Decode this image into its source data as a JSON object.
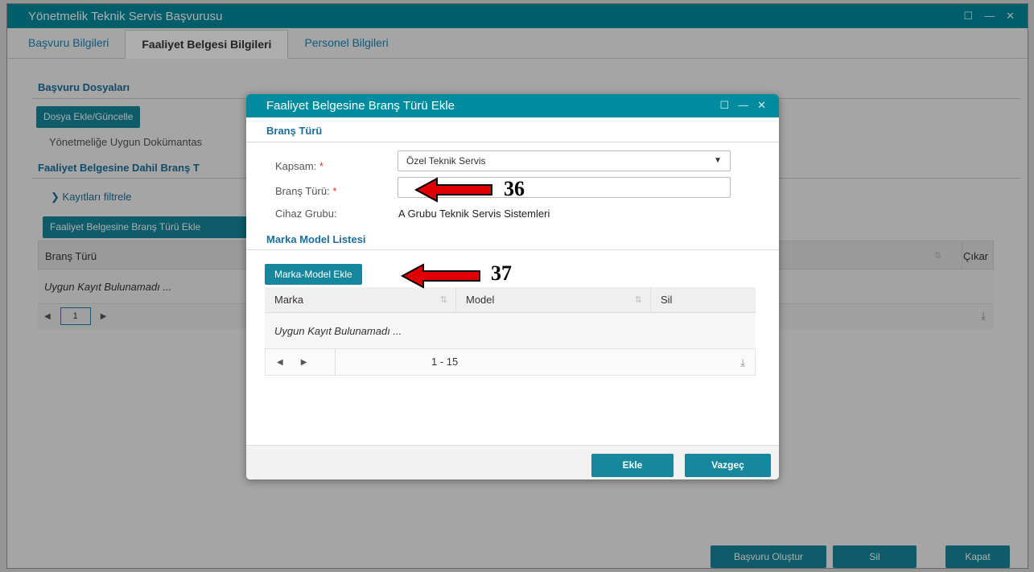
{
  "window": {
    "title": "Yönetmelik Teknik Servis Başvurusu"
  },
  "tabs": [
    {
      "label": "Başvuru Bilgileri"
    },
    {
      "label": "Faaliyet Belgesi Bilgileri"
    },
    {
      "label": "Personel Bilgileri"
    }
  ],
  "background": {
    "section_files": "Başvuru Dosyaları",
    "file_button": "Dosya Ekle/Güncelle",
    "file_text": "Yönetmeliğe Uygun Dokümantas",
    "section_branch": "Faaliyet Belgesine Dahil Branş T",
    "filter_label": "Kayıtları filtrele",
    "add_branch_button": "Faaliyet Belgesine Branş Türü Ekle",
    "col_branch": "Branş Türü",
    "col_remove": "Çıkar",
    "empty_text": "Uygun Kayıt Bulunamadı ...",
    "page_number": "1"
  },
  "footer": {
    "create_button": "Başvuru Oluştur",
    "delete_button": "Sil",
    "close_button": "Kapat"
  },
  "modal": {
    "title": "Faaliyet Belgesine Branş Türü Ekle",
    "section_branch": "Branş Türü",
    "scope_label": "Kapsam:",
    "scope_value": "Özel Teknik Servis",
    "branch_label": "Branş Türü:",
    "branch_value": "",
    "device_group_label": "Cihaz Grubu:",
    "device_group_value": "A Grubu Teknik Servis Sistemleri",
    "required_mark": "*",
    "section_brand": "Marka Model Listesi",
    "add_brand_button": "Marka-Model Ekle",
    "table": {
      "columns": [
        "Marka",
        "Model",
        "Sil"
      ],
      "empty_text": "Uygun Kayıt Bulunamadı ...",
      "range": "1 - 15"
    },
    "add_button": "Ekle",
    "cancel_button": "Vazgeç"
  },
  "annotations": {
    "label_36": "36",
    "label_37": "37"
  },
  "colors": {
    "accent": "#008b9e",
    "button": "#16879c",
    "link": "#1a84b6",
    "arrow": "#e00000"
  }
}
